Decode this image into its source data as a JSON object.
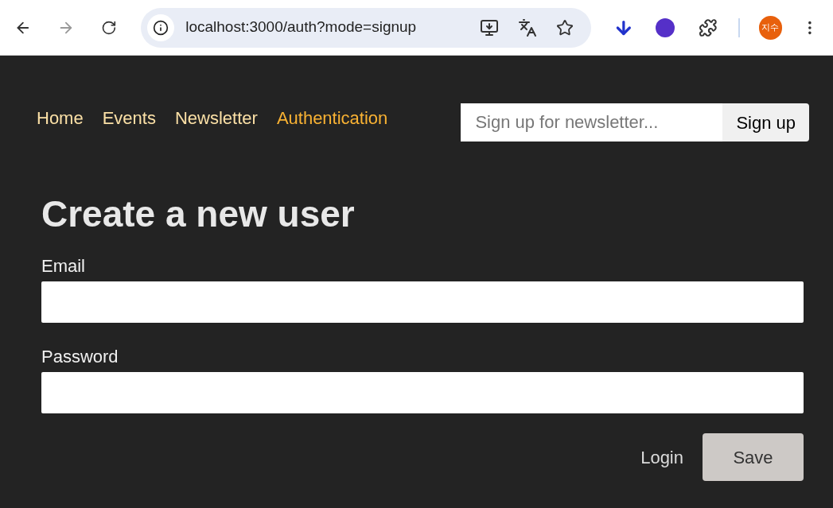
{
  "browser": {
    "url": "localhost:3000/auth?mode=signup",
    "profile": "지수"
  },
  "nav": {
    "links": [
      {
        "label": "Home",
        "selected": false
      },
      {
        "label": "Events",
        "selected": false
      },
      {
        "label": "Newsletter",
        "selected": false
      },
      {
        "label": "Authentication",
        "selected": true
      }
    ],
    "newsletter": {
      "placeholder": "Sign up for newsletter...",
      "button": "Sign up"
    }
  },
  "form": {
    "title": "Create a new user",
    "fields": [
      {
        "label": "Email"
      },
      {
        "label": "Password"
      }
    ],
    "switch_link": "Login",
    "submit": "Save"
  }
}
